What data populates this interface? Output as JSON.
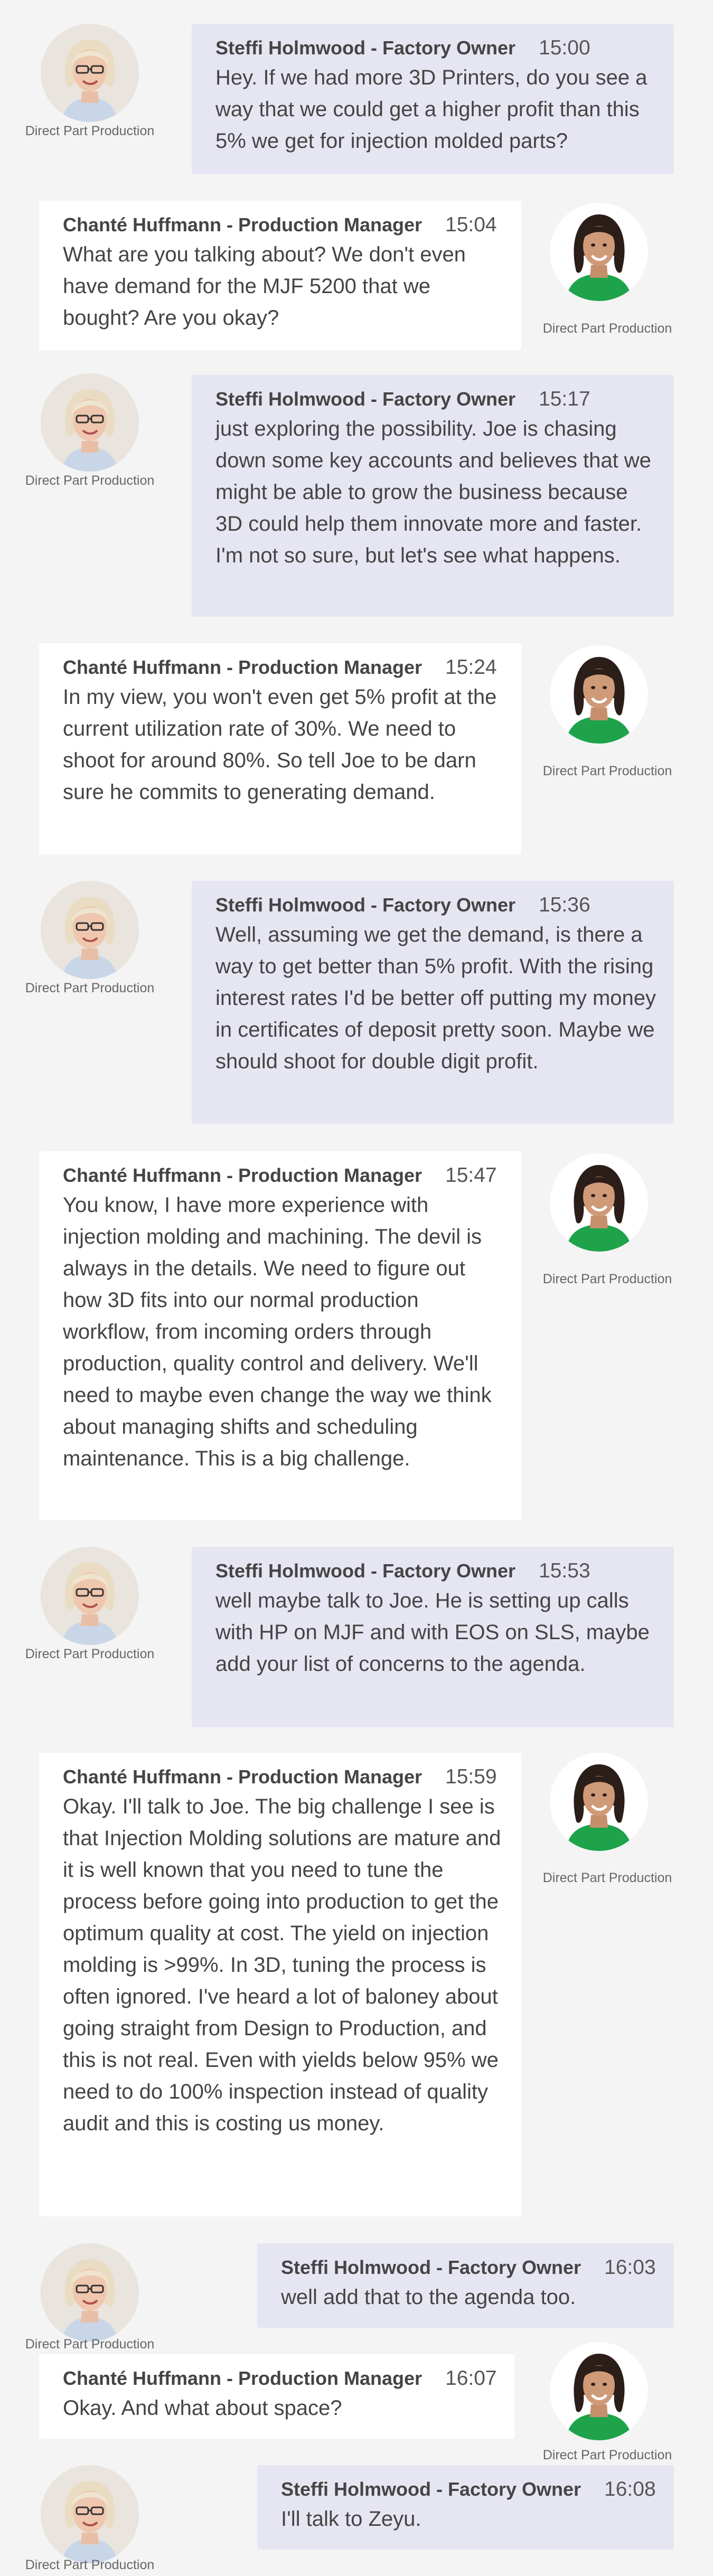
{
  "role_label": "Direct Part Production",
  "messages": [
    {
      "sender": "Steffi Holmwood - Factory Owner",
      "time": "15:00",
      "text": "Hey. If we had more 3D Printers, do you see a way that we could get a higher profit than this 5% we get for injection molded parts?"
    },
    {
      "sender": "Chanté Huffmann - Production Manager",
      "time": "15:04",
      "text": "What are you talking about? We don't even have demand for the MJF 5200 that we bought? Are you okay?"
    },
    {
      "sender": "Steffi Holmwood - Factory Owner",
      "time": "15:17",
      "text": "just exploring the possibility. Joe is chasing down some key accounts and believes that we might be able to grow the business because 3D could help them innovate more and faster. I'm not so sure, but let's see what happens."
    },
    {
      "sender": "Chanté Huffmann - Production Manager",
      "time": "15:24",
      "text": "In my view, you won't even get 5% profit at the current utilization rate of 30%. We need to shoot for around 80%. So tell Joe to be darn sure he commits to generating demand."
    },
    {
      "sender": "Steffi Holmwood - Factory Owner",
      "time": "15:36",
      "text": "Well, assuming we get the demand, is there a way to get better than 5% profit. With the rising interest rates I'd be better off putting my money in certificates of deposit pretty soon. Maybe we should shoot for double digit profit."
    },
    {
      "sender": "Chanté Huffmann - Production Manager",
      "time": "15:47",
      "text": "You know, I have more experience with injection molding and machining. The devil is always in the details. We need to figure out how 3D fits into our normal production workflow, from incoming orders through production, quality control and delivery. We'll need to maybe even change the way we think about managing shifts and scheduling maintenance. This is a big challenge."
    },
    {
      "sender": "Steffi Holmwood - Factory Owner",
      "time": "15:53",
      "text": "well maybe talk to Joe. He is setting up calls with HP on MJF and with EOS on SLS, maybe add your list of concerns to the agenda."
    },
    {
      "sender": "Chanté Huffmann - Production Manager",
      "time": "15:59",
      "text": "Okay. I'll talk to Joe. The big challenge I see is that Injection Molding solutions are mature and it is well known that you need to tune the process before going into production to get the optimum quality at cost. The yield on injection molding is >99%. In 3D, tuning the process is often ignored. I've heard a lot of baloney about going straight from Design to Production, and this is not real. Even with yields below 95% we need to do 100% inspection instead of quality audit and this is costing us money."
    },
    {
      "sender": "Steffi Holmwood - Factory Owner",
      "time": "16:03",
      "text": "well add that to the agenda too."
    },
    {
      "sender": "Chanté Huffmann - Production Manager",
      "time": "16:07",
      "text": "Okay. And what about space?"
    },
    {
      "sender": "Steffi Holmwood - Factory Owner",
      "time": "16:08",
      "text": "I'll talk to Zeyu."
    }
  ]
}
